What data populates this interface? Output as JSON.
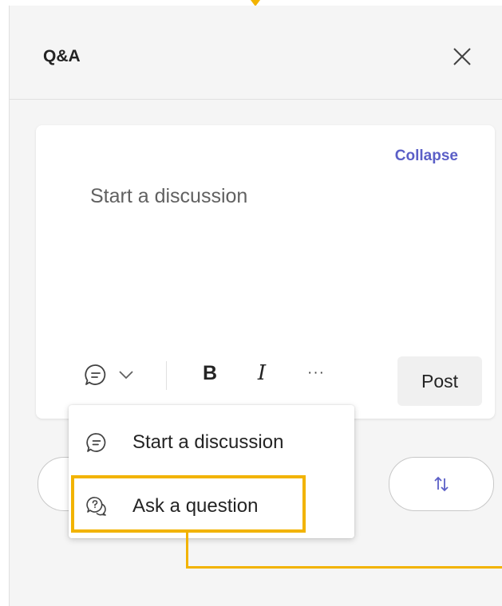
{
  "header": {
    "title": "Q&A",
    "close_icon": "close-icon"
  },
  "compose": {
    "collapse_label": "Collapse",
    "placeholder": "Start a discussion",
    "toolbar": {
      "post_type_icon": "chat-bubble-icon",
      "chevron_icon": "chevron-down-icon",
      "bold_label": "B",
      "italic_label": "I",
      "more_label": "···"
    },
    "post_label": "Post"
  },
  "sort": {
    "icon": "sort-arrows-icon"
  },
  "post_type_menu": {
    "items": [
      {
        "label": "Start a discussion",
        "icon": "chat-bubble-icon"
      },
      {
        "label": "Ask a question",
        "icon": "question-bubble-icon"
      }
    ]
  },
  "annotation": {
    "highlight_color": "#f2b300"
  },
  "colors": {
    "accent": "#5b5fc7",
    "text": "#242424",
    "muted": "#616161"
  }
}
